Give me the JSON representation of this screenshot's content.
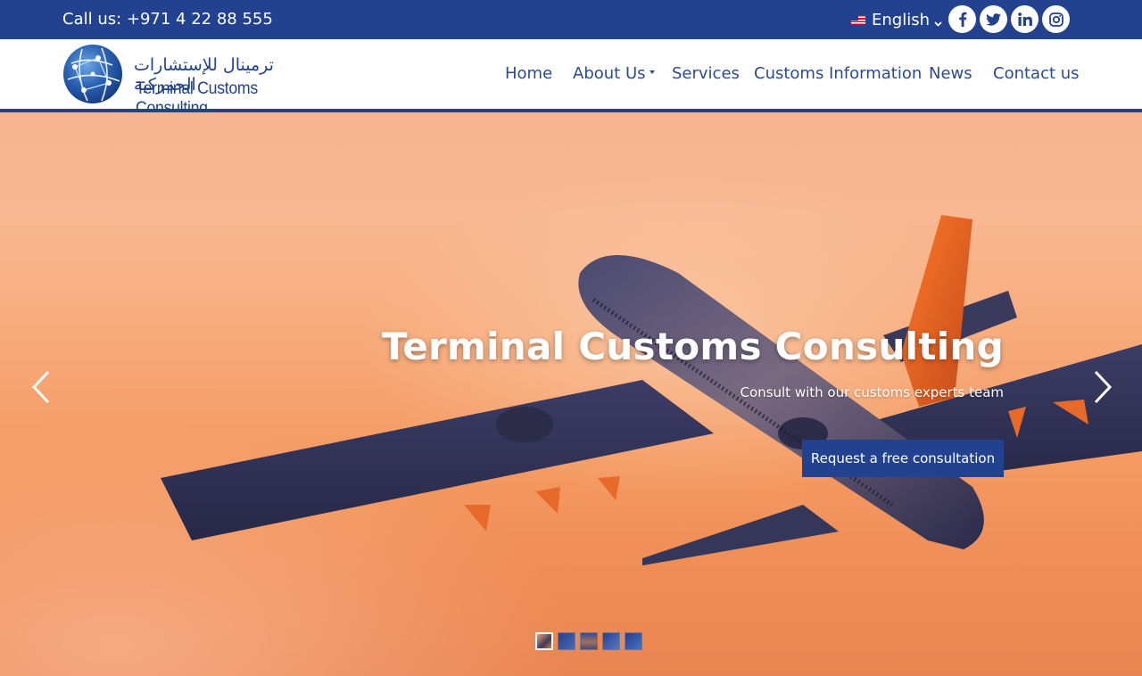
{
  "topbar": {
    "phone": "Call us: +971 4 22 88 555",
    "language": {
      "label": "English",
      "flag_icon": "uk-flag-icon",
      "chevron_icon": "chevron-down-icon"
    },
    "social": [
      {
        "name": "facebook",
        "icon": "facebook-icon"
      },
      {
        "name": "twitter",
        "icon": "twitter-icon"
      },
      {
        "name": "linkedin",
        "icon": "linkedin-icon"
      },
      {
        "name": "instagram",
        "icon": "instagram-icon"
      }
    ],
    "bg_color": "#22418f"
  },
  "logo": {
    "arabic": "ترمينال للإستشارات الجمركية",
    "english": "Terminal Customs Consulting"
  },
  "nav": {
    "items": [
      {
        "label": "Home"
      },
      {
        "label": "About Us",
        "has_dropdown": true
      },
      {
        "label": "Services"
      },
      {
        "label": "Customs Information"
      },
      {
        "label": "News"
      },
      {
        "label": "Contact us"
      }
    ]
  },
  "hero": {
    "title": "Terminal Customs Consulting",
    "subtitle": "Consult with our customs experts team",
    "cta": "Request a free consultation",
    "prev_icon": "chevron-left-icon",
    "next_icon": "chevron-right-icon",
    "slide_count": 5,
    "active_slide": 1
  },
  "colors": {
    "brand": "#22418f",
    "text_nav": "#2b4a8f"
  }
}
